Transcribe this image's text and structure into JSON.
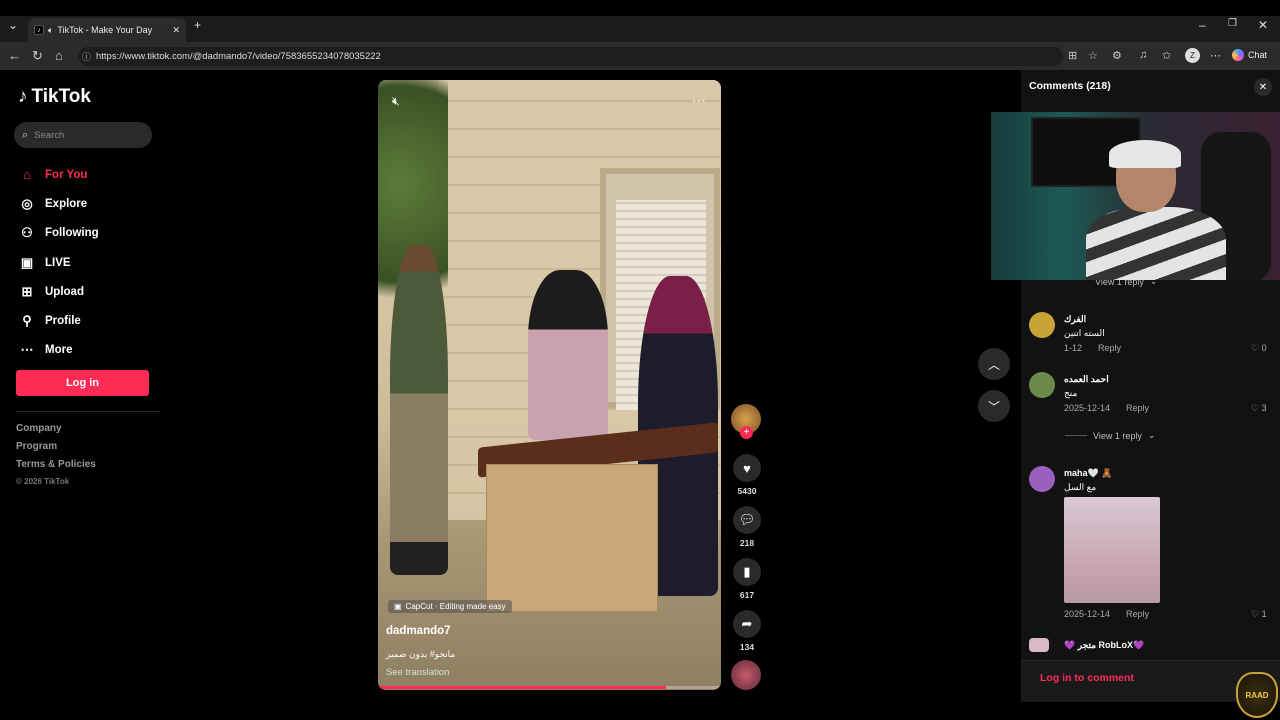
{
  "browser": {
    "tab_title": "TikTok - Make Your Day",
    "url": "https://www.tiktok.com/@dadmando7/video/7583655234078035222",
    "chat_label": "Chat",
    "profile_initial": "Z"
  },
  "sidebar": {
    "logo_text": "TikTok",
    "search_placeholder": "Search",
    "nav": [
      {
        "label": "For You",
        "icon": "home-icon"
      },
      {
        "label": "Explore",
        "icon": "compass-icon"
      },
      {
        "label": "Following",
        "icon": "following-icon"
      },
      {
        "label": "LIVE",
        "icon": "live-icon"
      },
      {
        "label": "Upload",
        "icon": "upload-icon"
      },
      {
        "label": "Profile",
        "icon": "profile-icon"
      },
      {
        "label": "More",
        "icon": "more-icon"
      }
    ],
    "login_label": "Log in",
    "footer": [
      "Company",
      "Program",
      "Terms & Policies"
    ],
    "copyright": "© 2026 TikTok"
  },
  "video": {
    "capcut_label": "CapCut · Editing made easy",
    "author": "dadmando7",
    "caption": "مانجو# بدون ضمير",
    "see_translation": "See translation",
    "progress": 0.84
  },
  "actions": {
    "likes": "5430",
    "comments": "218",
    "saves": "617",
    "shares": "134"
  },
  "comments": {
    "title": "Comments",
    "count": "(218)",
    "view_reply_top": "View 1 reply",
    "items": [
      {
        "name": "الفرك",
        "text": "السته اتنين",
        "date": "1-12",
        "reply": "Reply",
        "likes": "0",
        "avatar_color": "#c8a437"
      },
      {
        "name": "احمد العمده",
        "text": "منج",
        "date": "2025-12-14",
        "reply": "Reply",
        "likes": "3",
        "avatar_color": "#6a8a4a"
      },
      {
        "name": "maha🤍 🧸",
        "text": "مع السل",
        "date": "2025-12-14",
        "reply": "Reply",
        "likes": "1",
        "avatar_color": "#9a5fbf"
      },
      {
        "name": "💜 متجر RobLoX💜",
        "avatar_color": "#d9b8c8"
      }
    ],
    "view_reply_mid": "View 1 reply",
    "login_prompt": "Log in to comment"
  },
  "overlay": {
    "badge_text": "RAAD"
  }
}
